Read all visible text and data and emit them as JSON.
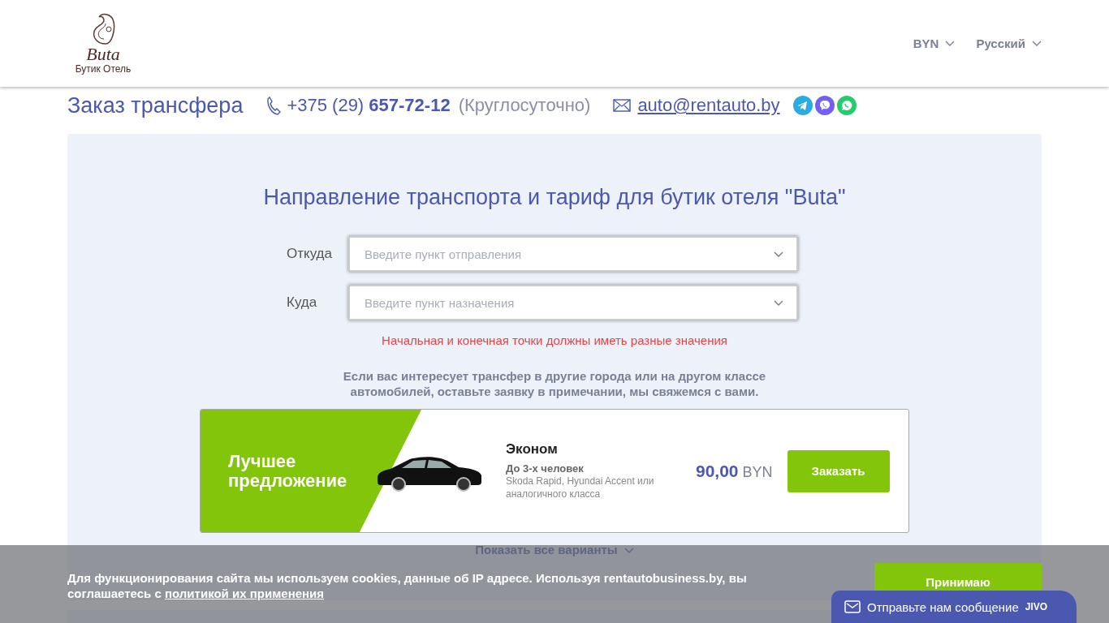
{
  "header": {
    "logo": {
      "name": "Buta",
      "subtitle": "Бутик Отель"
    },
    "selectors": [
      {
        "label": "BYN"
      },
      {
        "label": "Русский"
      }
    ]
  },
  "contact_bar": {
    "title": "Заказ трансфера",
    "phone_prefix": "+375 (29)",
    "phone_number": "657-72-12",
    "hours": "(Круглосуточно)",
    "email": "auto@rentauto.by",
    "messengers": [
      {
        "kind": "telegram",
        "color": "#2aabe2"
      },
      {
        "kind": "viber",
        "color": "#7360f2"
      },
      {
        "kind": "whatsapp",
        "color": "#25cc6b"
      }
    ]
  },
  "form": {
    "heading": "Направление транспорта и тариф для бутик отеля \"Buta\"",
    "fields": [
      {
        "label": "Откуда",
        "placeholder": "Введите пункт отправления"
      },
      {
        "label": "Куда",
        "placeholder": "Введите пункт назначения"
      }
    ],
    "error": "Начальная и конечная точки должны иметь разные значения",
    "note": "Если вас интересует трансфер в другие города или на другом классе автомобилей, оставьте заявку в примечании, мы свяжемся с вами."
  },
  "offer": {
    "badge": "Лучшее предложение",
    "class_name": "Эконом",
    "capacity": "До 3-х человек",
    "models": "Skoda Rapid, Hyundai Accent или аналогичного класса",
    "price": "90,00",
    "currency": "BYN",
    "button": "Заказать"
  },
  "show_all": "Показать все варианты",
  "cookie_banner": {
    "text_before": "Для функционирования сайта мы используем cookies, данные об IP адресе. Используя rentautobusiness.by, вы соглашаетесь с",
    "link": "политикой их применения",
    "button": "Принимаю"
  },
  "chat": {
    "label": "Отправьте нам сообщение",
    "brand": "JIVO"
  }
}
